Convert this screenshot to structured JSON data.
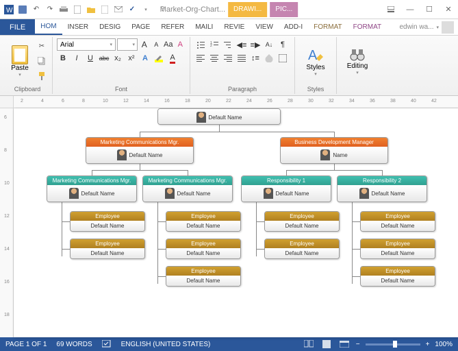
{
  "titlebar": {
    "doc_title": "Market-Org-Chart...",
    "ctx_drawing": "DRAWI...",
    "ctx_picture": "PIC..."
  },
  "tabs": {
    "file": "FILE",
    "home": "HOM",
    "insert": "INSER",
    "design": "DESIG",
    "page": "PAGE",
    "refer": "REFER",
    "mail": "MAILI",
    "review": "REVIE",
    "view": "VIEW",
    "addin": "ADD-I",
    "format1": "FORMAT",
    "format2": "FORMAT",
    "user": "edwin wa..."
  },
  "ribbon": {
    "clipboard": {
      "label": "Clipboard",
      "paste": "Paste"
    },
    "font": {
      "label": "Font",
      "name": "Arial",
      "size": "",
      "bold": "B",
      "italic": "I",
      "underline": "U",
      "strike": "abc",
      "sub": "x₂",
      "sup": "x²"
    },
    "paragraph": {
      "label": "Paragraph"
    },
    "styles": {
      "label": "Styles",
      "btn": "Styles"
    },
    "editing": {
      "label": "",
      "btn": "Editing"
    }
  },
  "ruler_h": [
    "2",
    "4",
    "6",
    "8",
    "10",
    "12",
    "14",
    "16",
    "18",
    "20",
    "22",
    "24",
    "26",
    "28",
    "30",
    "32",
    "34",
    "36",
    "38",
    "40",
    "42"
  ],
  "ruler_v": [
    "6",
    "8",
    "10",
    "12",
    "14",
    "16",
    "18"
  ],
  "chart": {
    "top": {
      "title": "",
      "name": "Default Name"
    },
    "l2a": {
      "title": "Marketing Communications Mgr.",
      "name": "Default Name"
    },
    "l2b": {
      "title": "Business Development Manager",
      "name": "Name"
    },
    "l3a": {
      "title": "Marketing Communications Mgr.",
      "name": "Default Name"
    },
    "l3b": {
      "title": "Marketing Communications Mgr.",
      "name": "Default Name"
    },
    "l3c": {
      "title": "Responsibility 1",
      "name": "Default Name"
    },
    "l3d": {
      "title": "Responsibility 2",
      "name": "Default Name"
    },
    "emp": "Employee",
    "def": "Default Name"
  },
  "status": {
    "page": "PAGE 1 OF 1",
    "words": "69 WORDS",
    "lang": "ENGLISH (UNITED STATES)",
    "zoom": "100%"
  }
}
